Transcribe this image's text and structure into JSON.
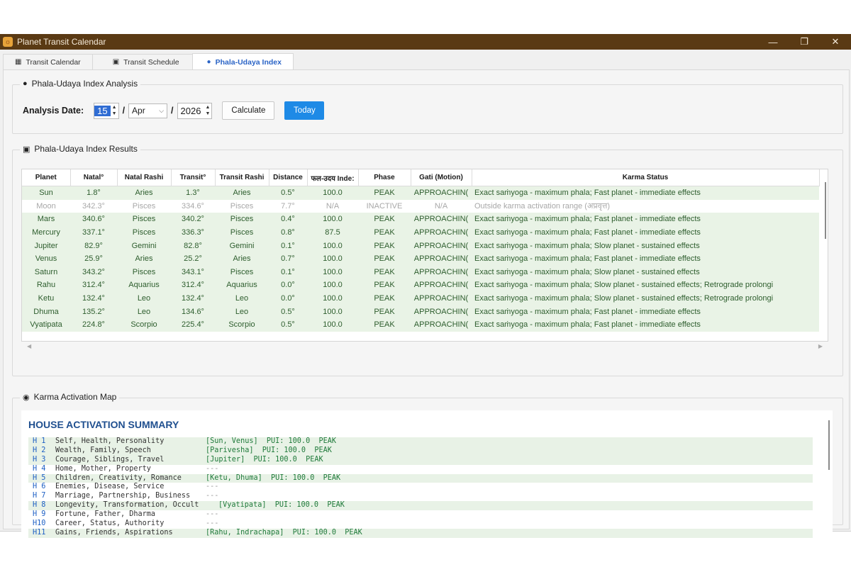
{
  "window": {
    "title": "Planet Transit Calendar",
    "minimize": "—",
    "maximize": "❐",
    "close": "✕"
  },
  "tabs": [
    {
      "label": "Transit Calendar",
      "icon": "calendar-icon"
    },
    {
      "label": "Transit Schedule",
      "icon": "schedule-icon"
    },
    {
      "label": "Phala-Udaya Index",
      "icon": "dot-icon"
    }
  ],
  "analysis": {
    "group_title": "Phala-Udaya Index Analysis",
    "date_label": "Analysis Date:",
    "day": "15",
    "month": "Apr",
    "year": "2026",
    "sep": "/",
    "calculate": "Calculate",
    "today": "Today"
  },
  "results": {
    "group_title": "Phala-Udaya Index Results",
    "columns": [
      "Planet",
      "Natal°",
      "Natal Rashi",
      "Transit°",
      "Transit Rashi",
      "Distance",
      "फल-उदय Inde:",
      "Phase",
      "Gati (Motion)",
      "Karma Status"
    ],
    "rows": [
      [
        "Sun",
        "1.8°",
        "Aries",
        "1.3°",
        "Aries",
        "0.5°",
        "100.0",
        "PEAK",
        "APPROACHIN(",
        "Exact saṁyoga - maximum phala; Fast planet - immediate effects"
      ],
      [
        "Moon",
        "342.3°",
        "Pisces",
        "334.6°",
        "Pisces",
        "7.7°",
        "N/A",
        "INACTIVE",
        "N/A",
        "Outside karma activation range (अप्रवृत्त)"
      ],
      [
        "Mars",
        "340.6°",
        "Pisces",
        "340.2°",
        "Pisces",
        "0.4°",
        "100.0",
        "PEAK",
        "APPROACHIN(",
        "Exact saṁyoga - maximum phala; Fast planet - immediate effects"
      ],
      [
        "Mercury",
        "337.1°",
        "Pisces",
        "336.3°",
        "Pisces",
        "0.8°",
        "87.5",
        "PEAK",
        "APPROACHIN(",
        "Exact saṁyoga - maximum phala; Fast planet - immediate effects"
      ],
      [
        "Jupiter",
        "82.9°",
        "Gemini",
        "82.8°",
        "Gemini",
        "0.1°",
        "100.0",
        "PEAK",
        "APPROACHIN(",
        "Exact saṁyoga - maximum phala; Slow planet - sustained effects"
      ],
      [
        "Venus",
        "25.9°",
        "Aries",
        "25.2°",
        "Aries",
        "0.7°",
        "100.0",
        "PEAK",
        "APPROACHIN(",
        "Exact saṁyoga - maximum phala; Fast planet - immediate effects"
      ],
      [
        "Saturn",
        "343.2°",
        "Pisces",
        "343.1°",
        "Pisces",
        "0.1°",
        "100.0",
        "PEAK",
        "APPROACHIN(",
        "Exact saṁyoga - maximum phala; Slow planet - sustained effects"
      ],
      [
        "Rahu",
        "312.4°",
        "Aquarius",
        "312.4°",
        "Aquarius",
        "0.0°",
        "100.0",
        "PEAK",
        "APPROACHIN(",
        "Exact saṁyoga - maximum phala; Slow planet - sustained effects; Retrograde prolongi"
      ],
      [
        "Ketu",
        "132.4°",
        "Leo",
        "132.4°",
        "Leo",
        "0.0°",
        "100.0",
        "PEAK",
        "APPROACHIN(",
        "Exact saṁyoga - maximum phala; Slow planet - sustained effects; Retrograde prolongi"
      ],
      [
        "Dhuma",
        "135.2°",
        "Leo",
        "134.6°",
        "Leo",
        "0.5°",
        "100.0",
        "PEAK",
        "APPROACHIN(",
        "Exact saṁyoga - maximum phala; Fast planet - immediate effects"
      ],
      [
        "Vyatipata",
        "224.8°",
        "Scorpio",
        "225.4°",
        "Scorpio",
        "0.5°",
        "100.0",
        "PEAK",
        "APPROACHIN(",
        "Exact saṁyoga - maximum phala; Fast planet - immediate effects"
      ]
    ]
  },
  "karma": {
    "group_title": "Karma Activation Map",
    "heading": "HOUSE ACTIVATION SUMMARY",
    "houses": [
      {
        "num": "H 1",
        "desc": "Self, Health, Personality",
        "planets": "[Sun, Venus]  PUI: 100.0  PEAK",
        "active": true
      },
      {
        "num": "H 2",
        "desc": "Wealth, Family, Speech",
        "planets": "[Parivesha]  PUI: 100.0  PEAK",
        "active": true
      },
      {
        "num": "H 3",
        "desc": "Courage, Siblings, Travel",
        "planets": "[Jupiter]  PUI: 100.0  PEAK",
        "active": true
      },
      {
        "num": "H 4",
        "desc": "Home, Mother, Property",
        "planets": "---",
        "active": false
      },
      {
        "num": "H 5",
        "desc": "Children, Creativity, Romance",
        "planets": "[Ketu, Dhuma]  PUI: 100.0  PEAK",
        "active": true
      },
      {
        "num": "H 6",
        "desc": "Enemies, Disease, Service",
        "planets": "---",
        "active": false
      },
      {
        "num": "H 7",
        "desc": "Marriage, Partnership, Business",
        "planets": "---",
        "active": false
      },
      {
        "num": "H 8",
        "desc": "Longevity, Transformation, Occult",
        "planets": "[Vyatipata]  PUI: 100.0  PEAK",
        "active": true
      },
      {
        "num": "H 9",
        "desc": "Fortune, Father, Dharma",
        "planets": "---",
        "active": false
      },
      {
        "num": "H10",
        "desc": "Career, Status, Authority",
        "planets": "---",
        "active": false
      },
      {
        "num": "H11",
        "desc": "Gains, Friends, Aspirations",
        "planets": "[Rahu, Indrachapa]  PUI: 100.0  PEAK",
        "active": true
      }
    ]
  }
}
